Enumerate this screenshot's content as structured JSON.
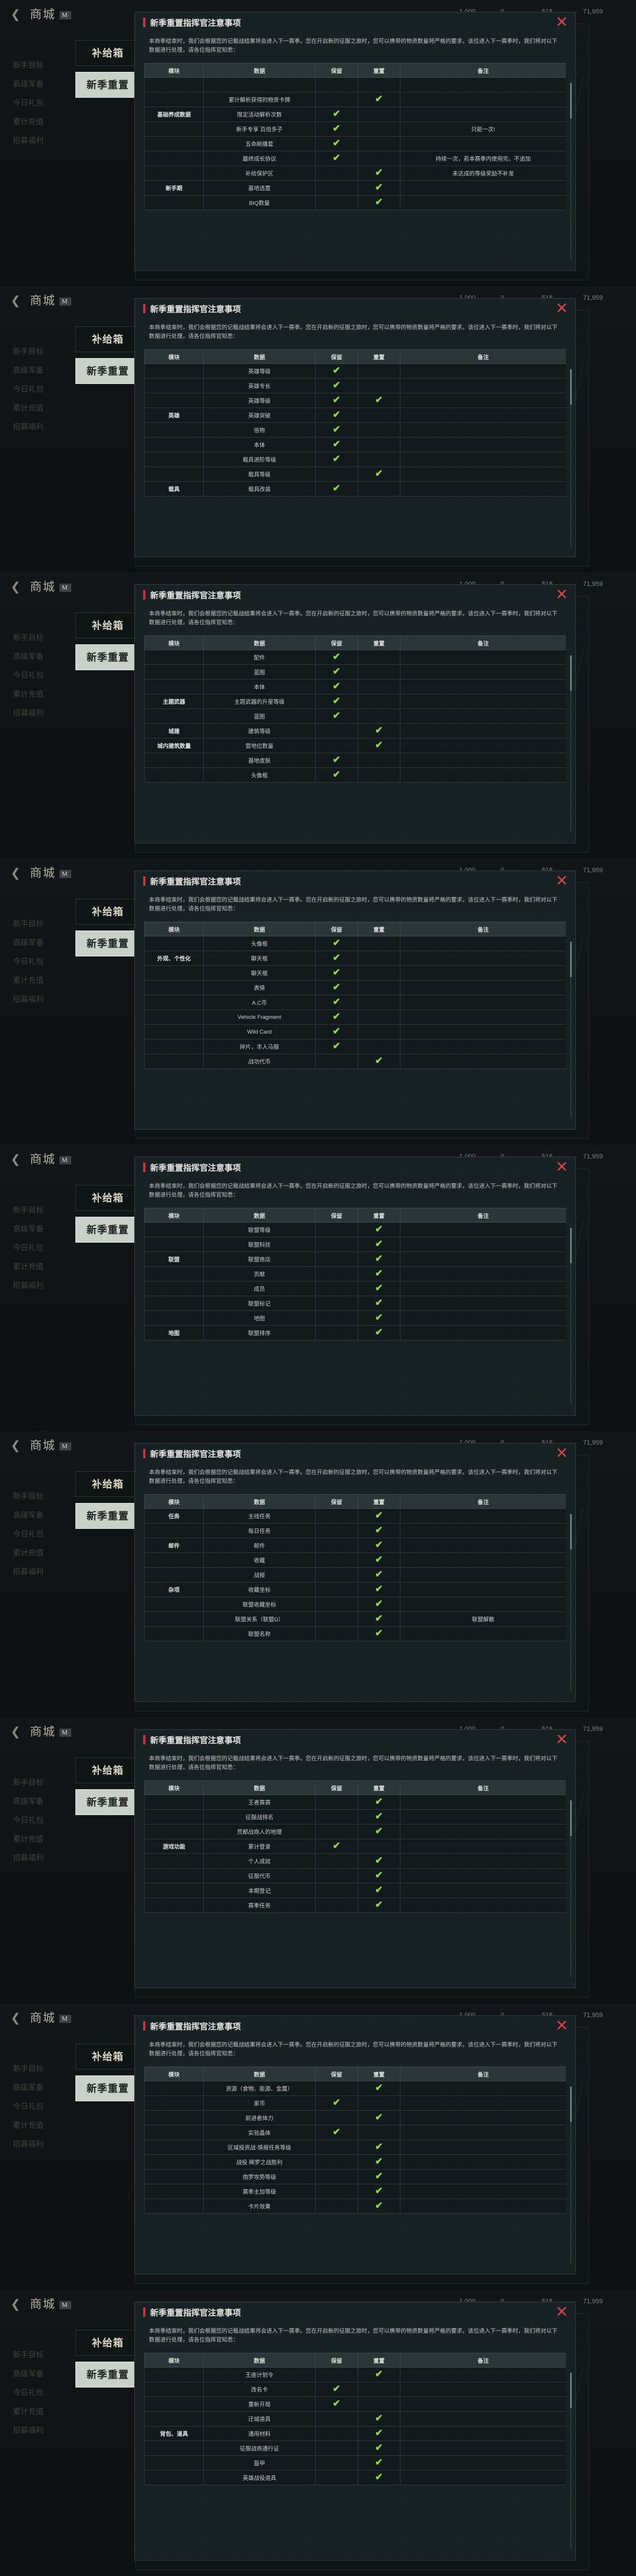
{
  "ui": {
    "dialog_title": "新季重置指挥官注意事项",
    "close_icon": "✕",
    "intro": "本商季结束时，我们会根据您的记载战结果将会进入下一赛季。您在开启新的征服之旅时，您可以携带的物资数量将严格的要求，该位进入下一赛季时，我们将对以下数据进行处理，请各位指挥官知悉：",
    "headers": {
      "module": "模块",
      "data": "数据",
      "keep": "保留",
      "reset": "重置",
      "note": "备注"
    },
    "check_icon": "✔",
    "bg_title": "商城",
    "bg_badge": "M",
    "bg_menu": [
      "新手目标",
      "高级军备",
      "今日礼包",
      "累计充值",
      "招募福利"
    ],
    "bg_resources": [
      "1,000",
      "0",
      "518",
      "71,959"
    ]
  },
  "pages": [
    {
      "tabs": [
        {
          "label": "补给箱",
          "active": false
        },
        {
          "label": "新季重置",
          "active": true
        }
      ],
      "rows": [
        {
          "module": "",
          "data": "",
          "keep": false,
          "reset": false,
          "note": ""
        },
        {
          "module": "",
          "data": "累计解析获得的物资卡牌",
          "keep": false,
          "reset": true,
          "note": ""
        },
        {
          "module": "基础养成数据",
          "data": "限定活动解析次数",
          "keep": true,
          "reset": false,
          "note": ""
        },
        {
          "module": "",
          "data": "新手专享 百倍多子",
          "keep": true,
          "reset": false,
          "note": "只能一次!"
        },
        {
          "module": "",
          "data": "五命刷播套",
          "keep": true,
          "reset": false,
          "note": ""
        },
        {
          "module": "",
          "data": "最终成长协议",
          "keep": true,
          "reset": false,
          "note": "持续一次，若本赛季内使用完，不追加"
        },
        {
          "module": "",
          "data": "补给保护区",
          "keep": false,
          "reset": true,
          "note": "未达成的等级奖励不补发"
        },
        {
          "module": "新手期",
          "data": "基地选置",
          "keep": false,
          "reset": true,
          "note": ""
        },
        {
          "module": "",
          "data": "BIQ数量",
          "keep": false,
          "reset": true,
          "note": ""
        }
      ]
    },
    {
      "tabs": [
        {
          "label": "补给箱",
          "active": false
        },
        {
          "label": "新季重置",
          "active": true
        }
      ],
      "rows": [
        {
          "module": "",
          "data": "英雄等级",
          "keep": true,
          "reset": false,
          "note": ""
        },
        {
          "module": "",
          "data": "英雄专长",
          "keep": true,
          "reset": false,
          "note": ""
        },
        {
          "module": "",
          "data": "英雄等级",
          "keep": true,
          "reset": true,
          "note": ""
        },
        {
          "module": "英雄",
          "data": "英雄突破",
          "keep": true,
          "reset": false,
          "note": ""
        },
        {
          "module": "",
          "data": "信物",
          "keep": true,
          "reset": false,
          "note": ""
        },
        {
          "module": "",
          "data": "本体",
          "keep": true,
          "reset": false,
          "note": ""
        },
        {
          "module": "",
          "data": "载具进阶等级",
          "keep": true,
          "reset": false,
          "note": ""
        },
        {
          "module": "",
          "data": "载具等级",
          "keep": false,
          "reset": true,
          "note": ""
        },
        {
          "module": "载具",
          "data": "载具改装",
          "keep": true,
          "reset": false,
          "note": ""
        }
      ]
    },
    {
      "tabs": [
        {
          "label": "补给箱",
          "active": false
        },
        {
          "label": "新季重置",
          "active": true
        }
      ],
      "rows": [
        {
          "module": "",
          "data": "配件",
          "keep": true,
          "reset": false,
          "note": ""
        },
        {
          "module": "",
          "data": "蓝图",
          "keep": true,
          "reset": false,
          "note": ""
        },
        {
          "module": "",
          "data": "本体",
          "keep": true,
          "reset": false,
          "note": ""
        },
        {
          "module": "主题武器",
          "data": "主题武器的升星等级",
          "keep": true,
          "reset": false,
          "note": ""
        },
        {
          "module": "",
          "data": "蓝图",
          "keep": true,
          "reset": false,
          "note": ""
        },
        {
          "module": "城建",
          "data": "建筑等级",
          "keep": false,
          "reset": true,
          "note": ""
        },
        {
          "module": "城内建筑数量",
          "data": "营地位数量",
          "keep": false,
          "reset": true,
          "note": ""
        },
        {
          "module": "",
          "data": "基地皮肤",
          "keep": true,
          "reset": false,
          "note": ""
        },
        {
          "module": "",
          "data": "头像框",
          "keep": true,
          "reset": false,
          "note": ""
        }
      ]
    },
    {
      "tabs": [
        {
          "label": "补给箱",
          "active": false
        },
        {
          "label": "新季重置",
          "active": true
        }
      ],
      "rows": [
        {
          "module": "",
          "data": "头像框",
          "keep": true,
          "reset": false,
          "note": ""
        },
        {
          "module": "外观、个性化",
          "data": "聊天框",
          "keep": true,
          "reset": false,
          "note": ""
        },
        {
          "module": "",
          "data": "聊天框",
          "keep": true,
          "reset": false,
          "note": ""
        },
        {
          "module": "",
          "data": "表情",
          "keep": true,
          "reset": false,
          "note": ""
        },
        {
          "module": "",
          "data": "A.C币",
          "keep": true,
          "reset": false,
          "note": ""
        },
        {
          "module": "",
          "data": "Vehicle Fragment",
          "keep": true,
          "reset": false,
          "note": ""
        },
        {
          "module": "",
          "data": "Wild Card",
          "keep": true,
          "reset": false,
          "note": ""
        },
        {
          "module": "",
          "data": "碎片，丰人马服",
          "keep": true,
          "reset": false,
          "note": ""
        },
        {
          "module": "",
          "data": "战功代币",
          "keep": false,
          "reset": true,
          "note": ""
        }
      ]
    },
    {
      "tabs": [
        {
          "label": "补给箱",
          "active": false
        },
        {
          "label": "新季重置",
          "active": true
        }
      ],
      "rows": [
        {
          "module": "",
          "data": "联盟等级",
          "keep": false,
          "reset": true,
          "note": ""
        },
        {
          "module": "",
          "data": "联盟科技",
          "keep": false,
          "reset": true,
          "note": ""
        },
        {
          "module": "联盟",
          "data": "联盟商店",
          "keep": false,
          "reset": true,
          "note": ""
        },
        {
          "module": "",
          "data": "贡献",
          "keep": false,
          "reset": true,
          "note": ""
        },
        {
          "module": "",
          "data": "成员",
          "keep": false,
          "reset": true,
          "note": ""
        },
        {
          "module": "",
          "data": "联盟标记",
          "keep": false,
          "reset": true,
          "note": ""
        },
        {
          "module": "",
          "data": "地图",
          "keep": false,
          "reset": true,
          "note": ""
        },
        {
          "module": "地图",
          "data": "联盟排序",
          "keep": false,
          "reset": true,
          "note": ""
        }
      ]
    },
    {
      "tabs": [
        {
          "label": "补给箱",
          "active": false
        },
        {
          "label": "新季重置",
          "active": true
        }
      ],
      "rows": [
        {
          "module": "任务",
          "data": "主线任务",
          "keep": false,
          "reset": true,
          "note": ""
        },
        {
          "module": "",
          "data": "每日任务",
          "keep": false,
          "reset": true,
          "note": ""
        },
        {
          "module": "邮件",
          "data": "邮件",
          "keep": false,
          "reset": true,
          "note": ""
        },
        {
          "module": "",
          "data": "收藏",
          "keep": false,
          "reset": true,
          "note": ""
        },
        {
          "module": "",
          "data": "战报",
          "keep": false,
          "reset": true,
          "note": ""
        },
        {
          "module": "杂项",
          "data": "收藏坐标",
          "keep": false,
          "reset": true,
          "note": ""
        },
        {
          "module": "",
          "data": "联盟收藏坐标",
          "keep": false,
          "reset": true,
          "note": ""
        },
        {
          "module": "",
          "data": "联盟关系（联盟Ω）",
          "keep": false,
          "reset": true,
          "note": "联盟解散"
        },
        {
          "module": "",
          "data": "联盟名称",
          "keep": false,
          "reset": true,
          "note": ""
        }
      ]
    },
    {
      "tabs": [
        {
          "label": "补给箱",
          "active": false
        },
        {
          "label": "新季重置",
          "active": true
        }
      ],
      "rows": [
        {
          "module": "",
          "data": "王者赛赛",
          "keep": false,
          "reset": true,
          "note": ""
        },
        {
          "module": "",
          "data": "征服战排名",
          "keep": false,
          "reset": true,
          "note": ""
        },
        {
          "module": "",
          "data": "荒都战商人的地理",
          "keep": false,
          "reset": true,
          "note": ""
        },
        {
          "module": "游戏功能",
          "data": "累计登录",
          "keep": true,
          "reset": false,
          "note": ""
        },
        {
          "module": "",
          "data": "个人成就",
          "keep": false,
          "reset": true,
          "note": ""
        },
        {
          "module": "",
          "data": "征服代币",
          "keep": false,
          "reset": true,
          "note": ""
        },
        {
          "module": "",
          "data": "本期登记",
          "keep": false,
          "reset": true,
          "note": ""
        },
        {
          "module": "",
          "data": "赛季任务",
          "keep": false,
          "reset": true,
          "note": ""
        }
      ]
    },
    {
      "tabs": [
        {
          "label": "补给箱",
          "active": false
        },
        {
          "label": "新季重置",
          "active": true
        }
      ],
      "rows": [
        {
          "module": "",
          "data": "资源（食物、能源、金属）",
          "keep": false,
          "reset": true,
          "note": ""
        },
        {
          "module": "",
          "data": "家币",
          "keep": true,
          "reset": false,
          "note": ""
        },
        {
          "module": "",
          "data": "前进者体力",
          "keep": false,
          "reset": true,
          "note": ""
        },
        {
          "module": "",
          "data": "实验晶体",
          "keep": true,
          "reset": false,
          "note": ""
        },
        {
          "module": "",
          "data": "区域投资战·情报任务等级",
          "keep": false,
          "reset": true,
          "note": ""
        },
        {
          "module": "",
          "data": "战役 稀罗之战胜利",
          "keep": false,
          "reset": true,
          "note": ""
        },
        {
          "module": "",
          "data": "炮罗攻势等级",
          "keep": false,
          "reset": true,
          "note": ""
        },
        {
          "module": "",
          "data": "赛季主加等级",
          "keep": false,
          "reset": true,
          "note": ""
        },
        {
          "module": "",
          "data": "卡片效果",
          "keep": false,
          "reset": true,
          "note": ""
        }
      ]
    },
    {
      "tabs": [
        {
          "label": "补给箱",
          "active": false
        },
        {
          "label": "新季重置",
          "active": true
        }
      ],
      "rows": [
        {
          "module": "",
          "data": "王座计划令",
          "keep": false,
          "reset": true,
          "note": ""
        },
        {
          "module": "",
          "data": "改名卡",
          "keep": true,
          "reset": false,
          "note": ""
        },
        {
          "module": "",
          "data": "重新开局",
          "keep": true,
          "reset": false,
          "note": ""
        },
        {
          "module": "",
          "data": "迁城道具",
          "keep": false,
          "reset": true,
          "note": ""
        },
        {
          "module": "背包、道具",
          "data": "通用材料",
          "keep": false,
          "reset": true,
          "note": ""
        },
        {
          "module": "",
          "data": "征服战商通行证",
          "keep": false,
          "reset": true,
          "note": ""
        },
        {
          "module": "",
          "data": "盔甲",
          "keep": false,
          "reset": true,
          "note": ""
        },
        {
          "module": "",
          "data": "英雄战役道具",
          "keep": false,
          "reset": true,
          "note": ""
        }
      ]
    }
  ]
}
